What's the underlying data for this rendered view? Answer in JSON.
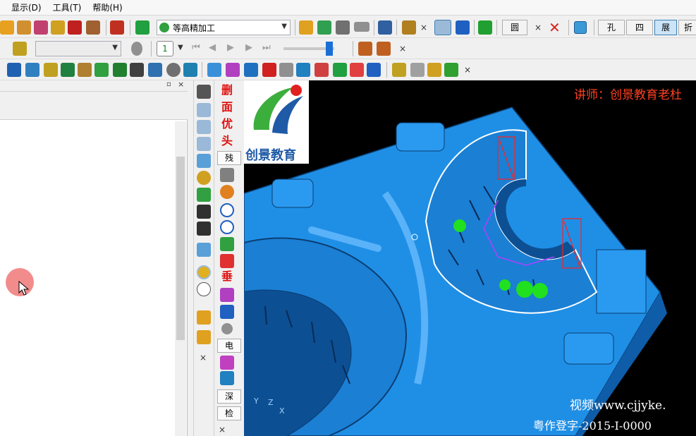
{
  "menu": {
    "items": [
      "显示(D)",
      "工具(T)",
      "帮助(H)"
    ]
  },
  "toolbar1": {
    "operation_combo": "等高精加工",
    "view_buttons": [
      "圆",
      "孔",
      "四",
      "展",
      "折"
    ],
    "active_view": "展"
  },
  "toolbar2": {
    "layer_value": "1"
  },
  "vertical_bar2": {
    "red_chars": [
      "删",
      "面",
      "优",
      "头",
      "垂"
    ],
    "buttons": [
      "残",
      "电",
      "深",
      "检"
    ]
  },
  "viewport": {
    "logo_text": "创景教育",
    "teacher_label": "讲师：创景教育老杜",
    "website_text": "视频www.cjjyke.",
    "copyright_text": "粤作登字-2015-I-0000",
    "axis_labels": [
      "Y",
      "Z",
      "X"
    ]
  },
  "colors": {
    "model_blue": "#1f8fe6",
    "viewport_bg": "#000000",
    "teacher_red": "#ff4020"
  }
}
